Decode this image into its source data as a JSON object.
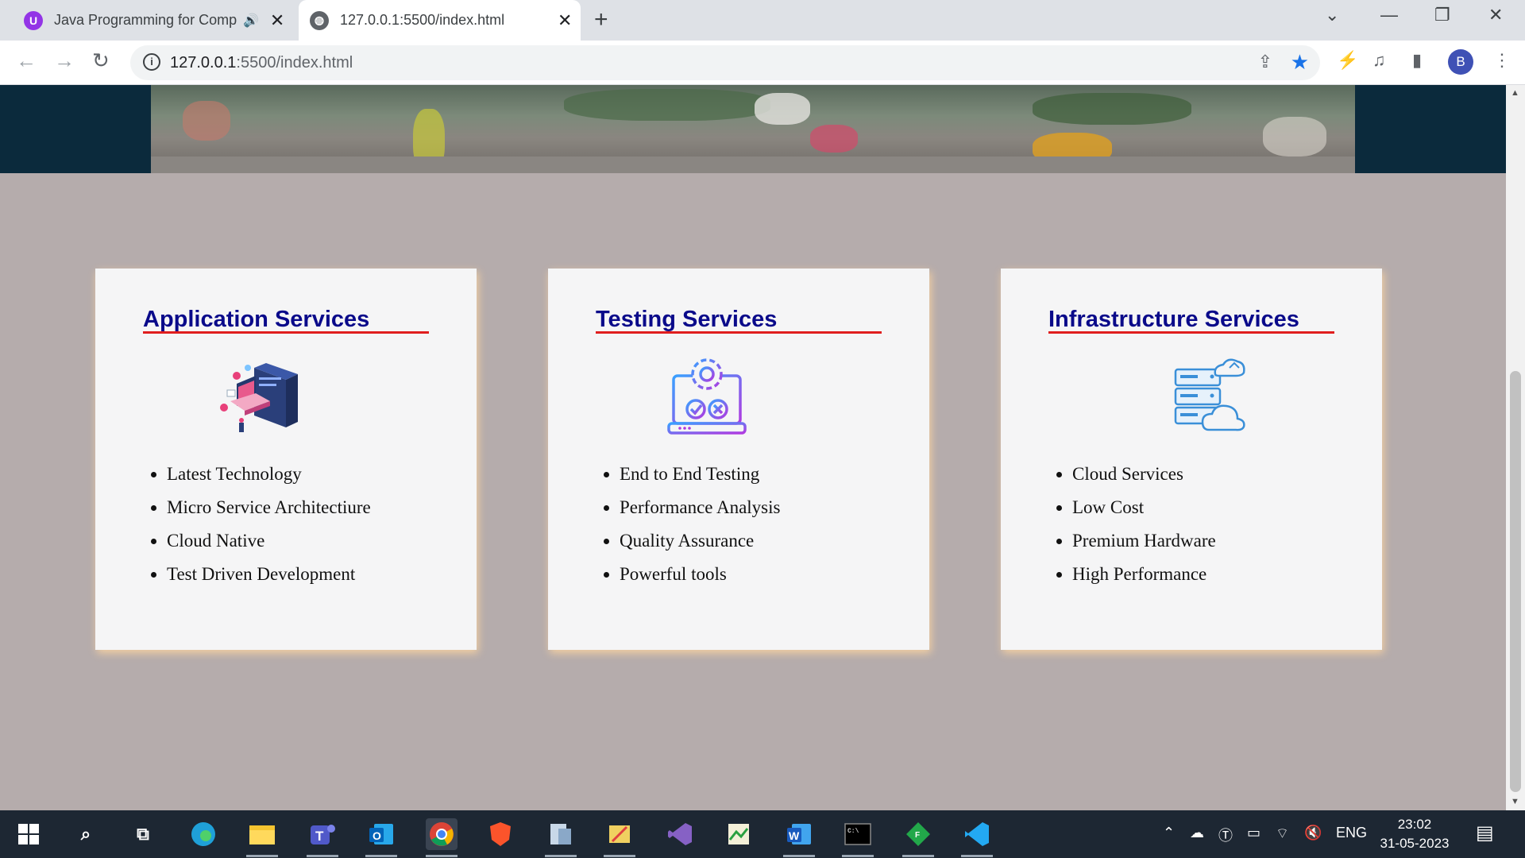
{
  "browser": {
    "tabs": [
      {
        "title": "Java Programming for Comp",
        "active": false,
        "audio": true
      },
      {
        "title": "127.0.0.1:5500/index.html",
        "active": true,
        "audio": false
      }
    ],
    "address": {
      "host": "127.0.0.1",
      "rest": ":5500/index.html"
    },
    "profile_initial": "B"
  },
  "services": [
    {
      "title": "Application Services",
      "icon": "developer-isometric-icon",
      "items": [
        "Latest Technology",
        "Micro Service Architectiure",
        "Cloud Native",
        "Test Driven Development"
      ]
    },
    {
      "title": "Testing Services",
      "icon": "testing-gear-laptop-icon",
      "items": [
        "End to End Testing",
        "Performance Analysis",
        "Quality Assurance",
        "Powerful tools"
      ]
    },
    {
      "title": "Infrastructure Services",
      "icon": "server-cloud-icon",
      "items": [
        "Cloud Services",
        "Low Cost",
        "Premium Hardware",
        "High Performance"
      ]
    }
  ],
  "colors": {
    "page_background": "#b5acac",
    "heading": "#0a0a8a",
    "heading_rule": "#e01e1e",
    "card_background": "#f5f5f6",
    "banner_frame": "#0b2a3c"
  },
  "taskbar": {
    "language": "ENG",
    "time": "23:02",
    "date": "31-05-2023",
    "apps": [
      "start-icon",
      "search-icon",
      "task-view-icon",
      "edge-icon",
      "file-explorer-icon",
      "teams-icon",
      "outlook-icon",
      "chrome-icon",
      "brave-icon",
      "app-icon",
      "app-icon",
      "visual-studio-icon",
      "app-icon",
      "word-icon",
      "terminal-icon",
      "app-icon",
      "vscode-icon"
    ]
  }
}
